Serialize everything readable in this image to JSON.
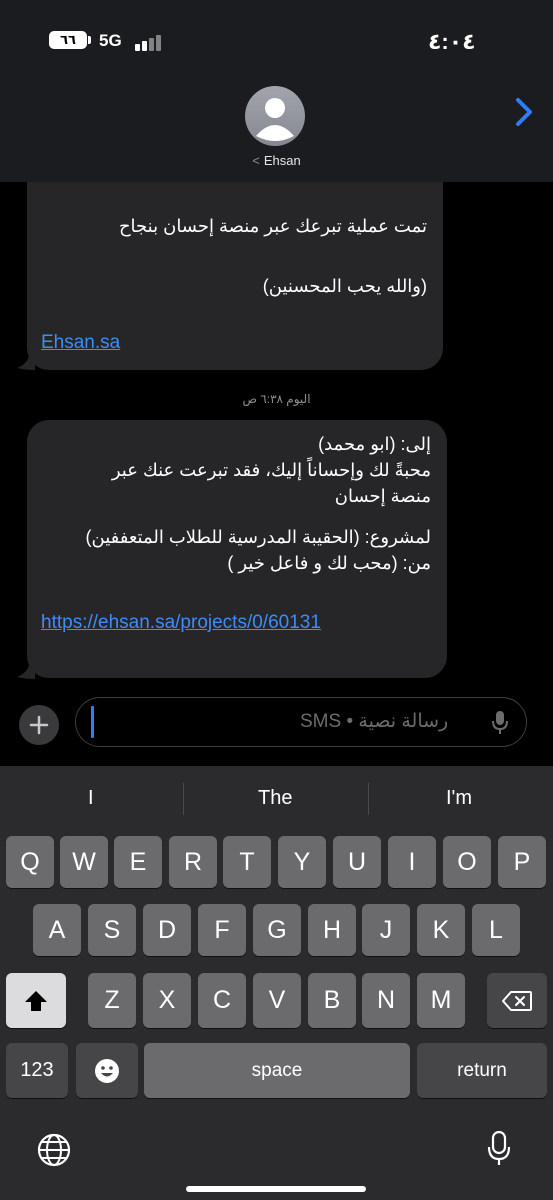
{
  "status_bar": {
    "time": "٤:٠٤",
    "battery": "٦٦",
    "network": "5G"
  },
  "header": {
    "contact_name": "Ehsan",
    "back_glyph": "<"
  },
  "messages": {
    "first": {
      "line1": "تمت عملية تبرعك عبر منصة إحسان بنجاح",
      "line2": "(والله يحب المحسنين)",
      "link": "Ehsan.sa"
    },
    "timestamp": "اليوم ٦:٣٨ ص",
    "second": {
      "lines": [
        "إلى: (ابو محمد)",
        "محبةً لك وإحساناً إليك، فقد تبرعت عنك عبر",
        "منصة إحسان",
        "لمشروع: (الحقيبة المدرسية للطلاب المتعففين)",
        "من: (محب لك و فاعل خير )"
      ],
      "link": "https://ehsan.sa/projects/0/60131"
    }
  },
  "compose": {
    "placeholder": "رسالة نصية • SMS"
  },
  "keyboard": {
    "suggestions": [
      "I",
      "The",
      "I'm"
    ],
    "row1": [
      "Q",
      "W",
      "E",
      "R",
      "T",
      "Y",
      "U",
      "I",
      "O",
      "P"
    ],
    "row2": [
      "A",
      "S",
      "D",
      "F",
      "G",
      "H",
      "J",
      "K",
      "L"
    ],
    "row3": [
      "Z",
      "X",
      "C",
      "V",
      "B",
      "N",
      "M"
    ],
    "numbers_label": "123",
    "space_label": "space",
    "return_label": "return"
  },
  "colors": {
    "link": "#3f8cf7",
    "bubble": "#262628",
    "header": "#1b1c1f",
    "keyboard": "#2b2b2d"
  }
}
